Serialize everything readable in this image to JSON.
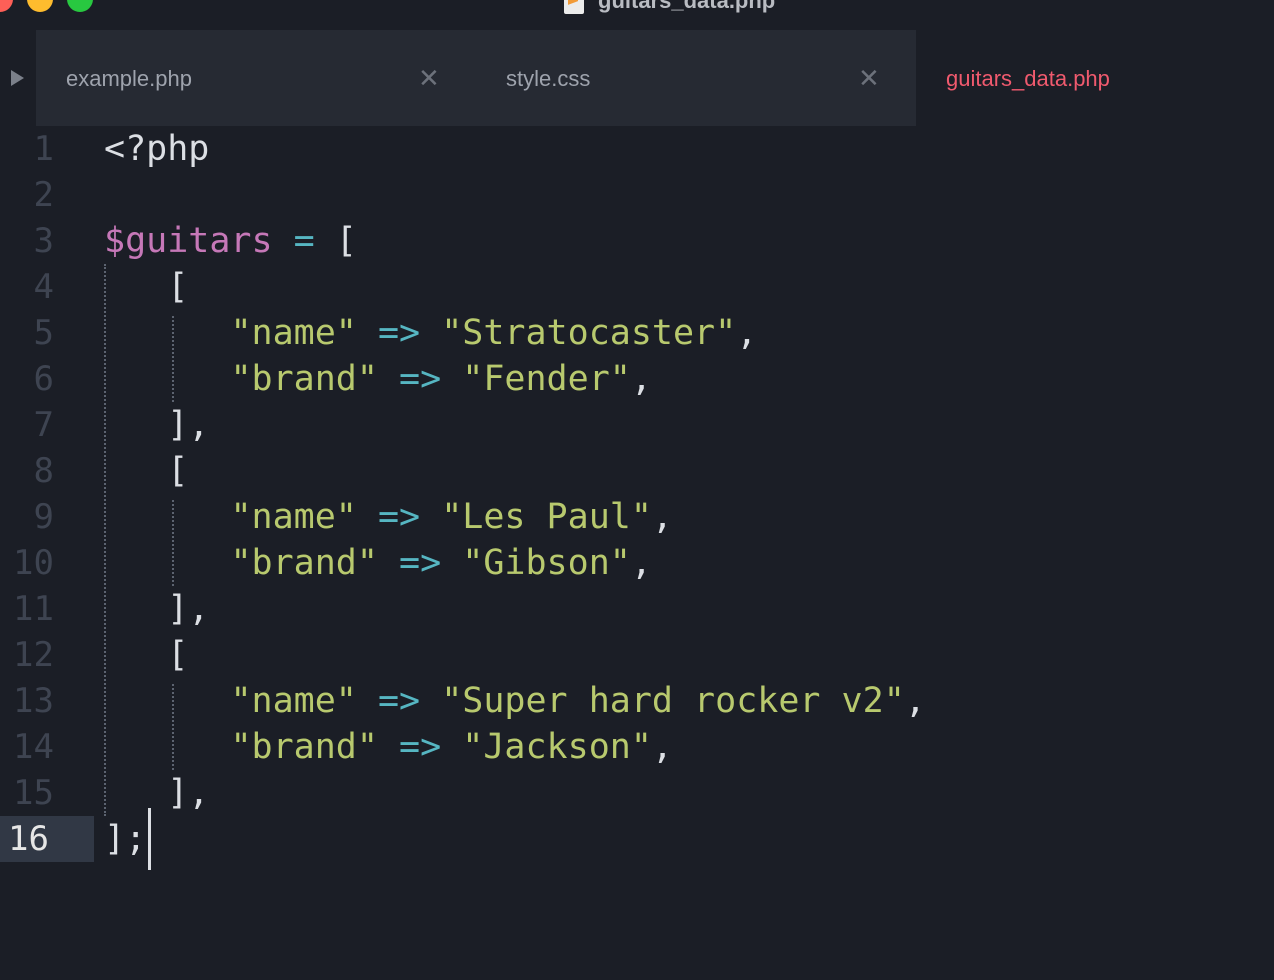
{
  "window": {
    "title": "guitars_data.php",
    "title_icon": "sublime-text-file-icon"
  },
  "tabs": [
    {
      "label": "example.php",
      "close": "✕",
      "active": false
    },
    {
      "label": "style.css",
      "close": "✕",
      "active": false
    },
    {
      "label": "guitars_data.php",
      "close": "",
      "active": true
    }
  ],
  "editor": {
    "current_line": "16",
    "line_numbers": [
      "1",
      "2",
      "3",
      "4",
      "5",
      "6",
      "7",
      "8",
      "9",
      "10",
      "11",
      "12",
      "13",
      "14",
      "15",
      "16"
    ],
    "lines": [
      {
        "tokens": [
          {
            "t": "<?php",
            "k": "plain"
          }
        ]
      },
      {
        "tokens": []
      },
      {
        "tokens": [
          {
            "t": "$guitars",
            "k": "var"
          },
          {
            "t": " ",
            "k": "plain"
          },
          {
            "t": "=",
            "k": "op"
          },
          {
            "t": " [",
            "k": "plain"
          }
        ]
      },
      {
        "tokens": [
          {
            "t": "   [",
            "k": "plain"
          }
        ]
      },
      {
        "tokens": [
          {
            "t": "      ",
            "k": "plain"
          },
          {
            "t": "\"name\"",
            "k": "str"
          },
          {
            "t": " ",
            "k": "plain"
          },
          {
            "t": "=>",
            "k": "op"
          },
          {
            "t": " ",
            "k": "plain"
          },
          {
            "t": "\"Stratocaster\"",
            "k": "str"
          },
          {
            "t": ",",
            "k": "plain"
          }
        ]
      },
      {
        "tokens": [
          {
            "t": "      ",
            "k": "plain"
          },
          {
            "t": "\"brand\"",
            "k": "str"
          },
          {
            "t": " ",
            "k": "plain"
          },
          {
            "t": "=>",
            "k": "op"
          },
          {
            "t": " ",
            "k": "plain"
          },
          {
            "t": "\"Fender\"",
            "k": "str"
          },
          {
            "t": ",",
            "k": "plain"
          }
        ]
      },
      {
        "tokens": [
          {
            "t": "   ],",
            "k": "plain"
          }
        ]
      },
      {
        "tokens": [
          {
            "t": "   [",
            "k": "plain"
          }
        ]
      },
      {
        "tokens": [
          {
            "t": "      ",
            "k": "plain"
          },
          {
            "t": "\"name\"",
            "k": "str"
          },
          {
            "t": " ",
            "k": "plain"
          },
          {
            "t": "=>",
            "k": "op"
          },
          {
            "t": " ",
            "k": "plain"
          },
          {
            "t": "\"Les Paul\"",
            "k": "str"
          },
          {
            "t": ",",
            "k": "plain"
          }
        ]
      },
      {
        "tokens": [
          {
            "t": "      ",
            "k": "plain"
          },
          {
            "t": "\"brand\"",
            "k": "str"
          },
          {
            "t": " ",
            "k": "plain"
          },
          {
            "t": "=>",
            "k": "op"
          },
          {
            "t": " ",
            "k": "plain"
          },
          {
            "t": "\"Gibson\"",
            "k": "str"
          },
          {
            "t": ",",
            "k": "plain"
          }
        ]
      },
      {
        "tokens": [
          {
            "t": "   ],",
            "k": "plain"
          }
        ]
      },
      {
        "tokens": [
          {
            "t": "   [",
            "k": "plain"
          }
        ]
      },
      {
        "tokens": [
          {
            "t": "      ",
            "k": "plain"
          },
          {
            "t": "\"name\"",
            "k": "str"
          },
          {
            "t": " ",
            "k": "plain"
          },
          {
            "t": "=>",
            "k": "op"
          },
          {
            "t": " ",
            "k": "plain"
          },
          {
            "t": "\"Super hard rocker v2\"",
            "k": "str"
          },
          {
            "t": ",",
            "k": "plain"
          }
        ]
      },
      {
        "tokens": [
          {
            "t": "      ",
            "k": "plain"
          },
          {
            "t": "\"brand\"",
            "k": "str"
          },
          {
            "t": " ",
            "k": "plain"
          },
          {
            "t": "=>",
            "k": "op"
          },
          {
            "t": " ",
            "k": "plain"
          },
          {
            "t": "\"Jackson\"",
            "k": "str"
          },
          {
            "t": ",",
            "k": "plain"
          }
        ]
      },
      {
        "tokens": [
          {
            "t": "   ],",
            "k": "plain"
          }
        ]
      },
      {
        "tokens": [
          {
            "t": "];",
            "k": "plain"
          }
        ]
      }
    ]
  },
  "colors": {
    "background": "#1b1e26",
    "tab_inactive": "#262a33",
    "tab_active_text": "#f05a6e",
    "variable": "#c678b8",
    "operator": "#56b6c2",
    "string": "#b8c96e",
    "text": "#dcdfe4"
  }
}
